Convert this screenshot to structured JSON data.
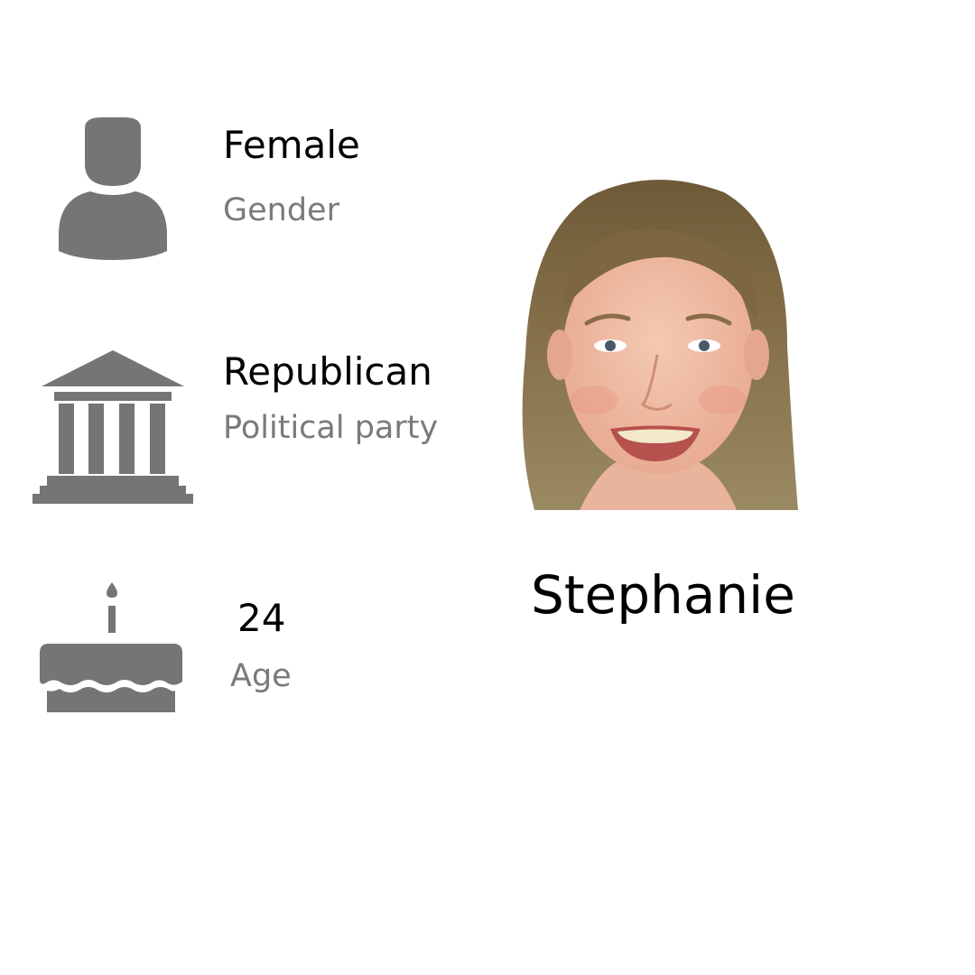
{
  "profile": {
    "name": "Stephanie",
    "photo": {
      "icon": "portrait-photo-placeholder"
    },
    "attributes": [
      {
        "icon": "person-icon",
        "value": "Female",
        "label": "Gender"
      },
      {
        "icon": "government-building-icon",
        "value": "Republican",
        "label": "Political party"
      },
      {
        "icon": "birthday-cake-icon",
        "value": "24",
        "label": "Age"
      }
    ]
  },
  "colors": {
    "icon": "#757577",
    "value_text": "#000000",
    "label_text": "#7a7a7c",
    "background": "#ffffff"
  }
}
